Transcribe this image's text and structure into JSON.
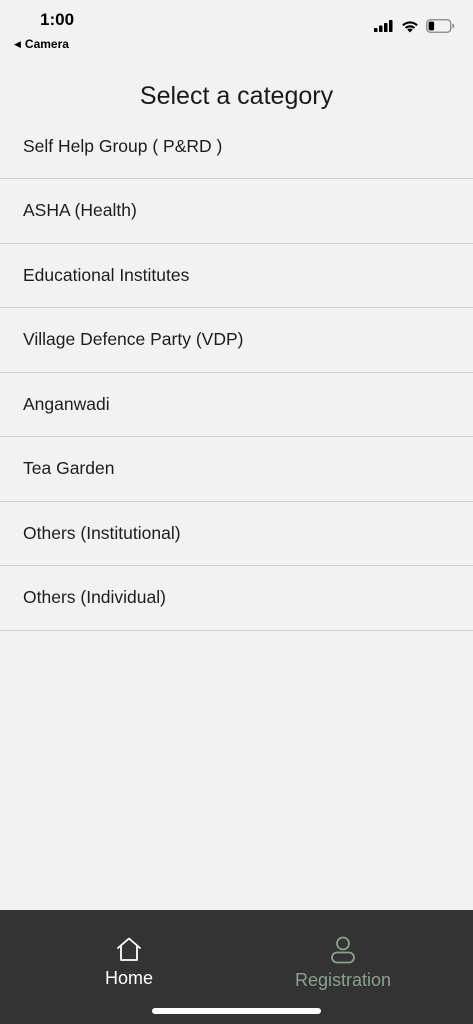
{
  "status_bar": {
    "time": "1:00",
    "back_app": "Camera",
    "icons": [
      "cellular-signal-icon",
      "wifi-icon",
      "battery-icon"
    ]
  },
  "page": {
    "title": "Select a category"
  },
  "categories": [
    {
      "label": "Self Help Group ( P&RD )"
    },
    {
      "label": "ASHA (Health)"
    },
    {
      "label": "Educational Institutes"
    },
    {
      "label": "Village Defence Party (VDP)"
    },
    {
      "label": "Anganwadi"
    },
    {
      "label": "Tea Garden"
    },
    {
      "label": "Others (Institutional)"
    },
    {
      "label": "Others (Individual)"
    }
  ],
  "tabbar": {
    "home": {
      "label": "Home",
      "icon": "home-icon",
      "color": "#ffffff"
    },
    "registration": {
      "label": "Registration",
      "icon": "person-icon",
      "color": "#8aa190"
    },
    "background": "#333333"
  }
}
